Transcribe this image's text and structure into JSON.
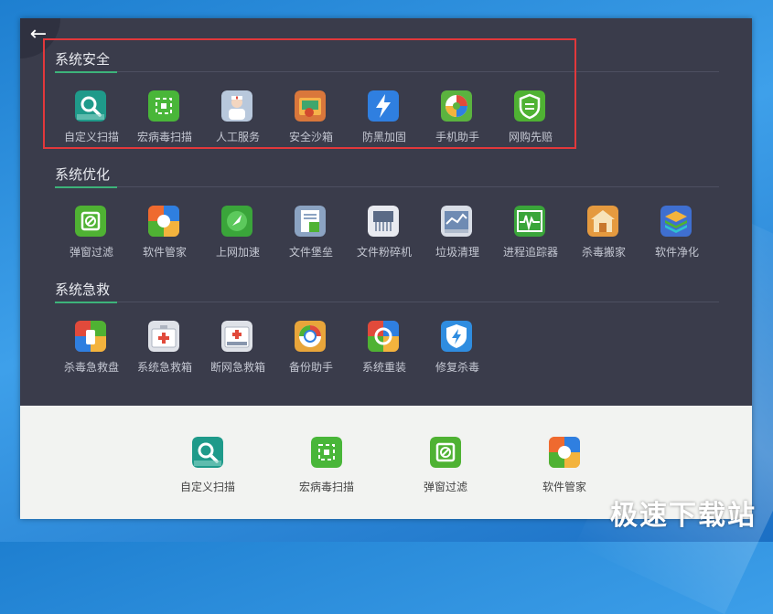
{
  "window": {
    "back_symbol": "←"
  },
  "sections": [
    {
      "title": "系统安全",
      "items": [
        {
          "label": "自定义扫描",
          "icon": "custom-scan-icon",
          "color": "#1f9a8a"
        },
        {
          "label": "宏病毒扫描",
          "icon": "macro-virus-scan-icon",
          "color": "#49b639"
        },
        {
          "label": "人工服务",
          "icon": "human-service-icon",
          "color": "#b8c8dc"
        },
        {
          "label": "安全沙箱",
          "icon": "sandbox-icon",
          "color": "#d9773b"
        },
        {
          "label": "防黑加固",
          "icon": "anti-hack-icon",
          "color": "#2f7fe0"
        },
        {
          "label": "手机助手",
          "icon": "phone-assistant-icon",
          "color": "#5bb33f"
        },
        {
          "label": "网购先赔",
          "icon": "shopping-compensation-icon",
          "color": "#4fb233"
        }
      ]
    },
    {
      "title": "系统优化",
      "items": [
        {
          "label": "弹窗过滤",
          "icon": "popup-filter-icon",
          "color": "#4fb233"
        },
        {
          "label": "软件管家",
          "icon": "software-manager-icon",
          "color": "#ef6a2f"
        },
        {
          "label": "上网加速",
          "icon": "web-accelerate-icon",
          "color": "#3aa53a"
        },
        {
          "label": "文件堡垒",
          "icon": "file-fortress-icon",
          "color": "#8ba3c2"
        },
        {
          "label": "文件粉碎机",
          "icon": "file-shredder-icon",
          "color": "#e8eaf0"
        },
        {
          "label": "垃圾清理",
          "icon": "junk-clean-icon",
          "color": "#d8dde6"
        },
        {
          "label": "进程追踪器",
          "icon": "process-tracker-icon",
          "color": "#3aa53a"
        },
        {
          "label": "杀毒搬家",
          "icon": "antivirus-move-icon",
          "color": "#e59a3f"
        },
        {
          "label": "软件净化",
          "icon": "software-purify-icon",
          "color": "#3f6fd0"
        }
      ]
    },
    {
      "title": "系统急救",
      "items": [
        {
          "label": "杀毒急救盘",
          "icon": "rescue-disk-icon",
          "color": "#e14a3b"
        },
        {
          "label": "系统急救箱",
          "icon": "system-rescue-kit-icon",
          "color": "#dfe2e8"
        },
        {
          "label": "断网急救箱",
          "icon": "network-rescue-kit-icon",
          "color": "#dfe2e8"
        },
        {
          "label": "备份助手",
          "icon": "backup-assistant-icon",
          "color": "#e8a53a"
        },
        {
          "label": "系统重装",
          "icon": "system-reinstall-icon",
          "color": "#e14a3b"
        },
        {
          "label": "修复杀毒",
          "icon": "repair-antivirus-icon",
          "color": "#2f8de0"
        }
      ]
    }
  ],
  "bottom_bar": {
    "items": [
      {
        "label": "自定义扫描",
        "icon": "custom-scan-icon"
      },
      {
        "label": "宏病毒扫描",
        "icon": "macro-virus-scan-icon"
      },
      {
        "label": "弹窗过滤",
        "icon": "popup-filter-icon"
      },
      {
        "label": "软件管家",
        "icon": "software-manager-icon"
      }
    ]
  },
  "watermark": "极速下载站"
}
